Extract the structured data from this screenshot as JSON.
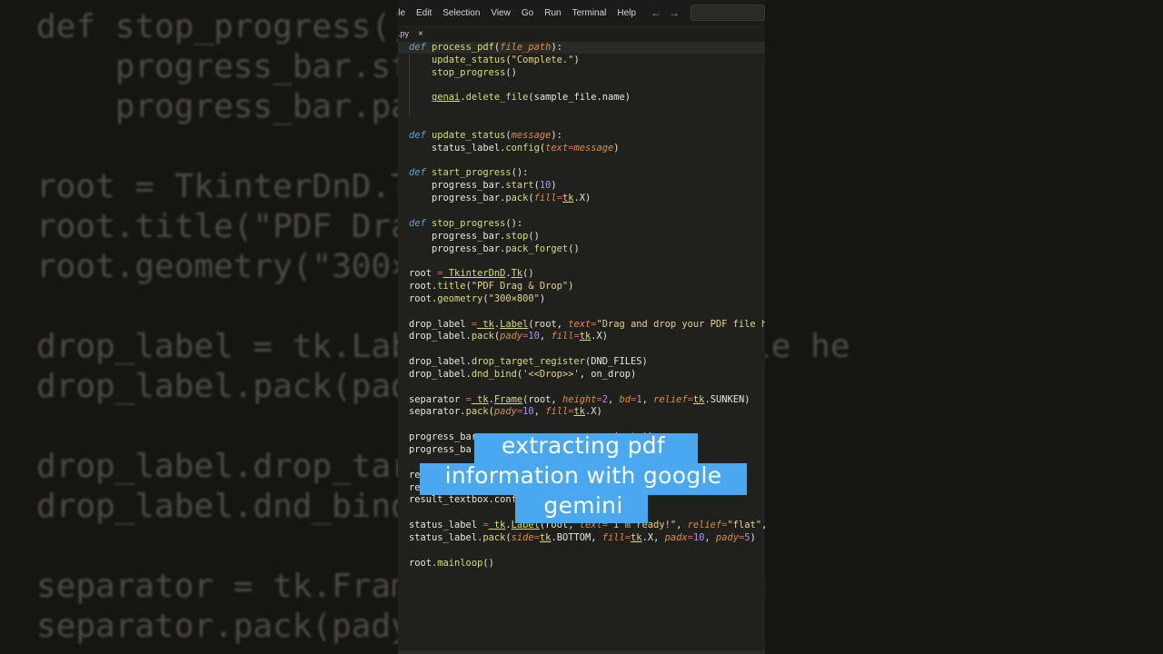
{
  "menubar": {
    "items": [
      "ile",
      "Edit",
      "Selection",
      "View",
      "Go",
      "Run",
      "Terminal",
      "Help"
    ],
    "back_icon": "←",
    "forward_icon": "→"
  },
  "tab": {
    "label": ".py",
    "close": "×"
  },
  "caption": {
    "line1": "extracting pdf",
    "line2": "information with google",
    "line3": "gemini"
  },
  "background": {
    "left_lines": [
      "def stop_progress():",
      "    progress_bar.stop",
      "    progress_bar.pack",
      "",
      "root = TkinterDnD.Tk(",
      "root.title(\"PDF Drag",
      "root.geometry(\"300×80",
      "",
      "drop_label = tk.Label",
      "drop_label.pack(pady",
      "",
      "drop_label.drop_targe",
      "drop_label.dnd_bind(",
      "",
      "separator = tk.Frame(",
      "separator.pack(pady=1"
    ],
    "right_lines": [
      "",
      "",
      "",
      "",
      "",
      "",
      "",
      "",
      "d drop your PDF file he",
      "",
      "",
      "",
      "",
      "",
      ", relief=tk.SUNKEN)",
      ""
    ]
  },
  "colors": {
    "caption_bg": "#49a8ef",
    "editor_bg": "#20201d",
    "keyword": "#6aa0d8",
    "function": "#d8dd7a",
    "string": "#e6d28a",
    "param": "#e08a4a",
    "number": "#b48ef0",
    "operator": "#e06060"
  },
  "code_lines": [
    [
      [
        "k",
        "def "
      ],
      [
        "f",
        "process_pdf"
      ],
      [
        "",
        "("
      ],
      [
        "p",
        "file_path"
      ],
      [
        "",
        "):"
      ]
    ],
    [
      [
        "",
        "    "
      ],
      [
        "f",
        "update_status"
      ],
      [
        "",
        "("
      ],
      [
        "s",
        "\"Complete.\""
      ],
      [
        "",
        ")"
      ]
    ],
    [
      [
        "",
        "    "
      ],
      [
        "f",
        "stop_progress"
      ],
      [
        "",
        "()"
      ]
    ],
    [],
    [
      [
        "",
        "    "
      ],
      [
        "u",
        "genai"
      ],
      [
        "",
        "."
      ],
      [
        "f",
        "delete_file"
      ],
      [
        "",
        "(sample_file.name)"
      ]
    ],
    [],
    [],
    [
      [
        "k",
        "def "
      ],
      [
        "f",
        "update_status"
      ],
      [
        "",
        "("
      ],
      [
        "p",
        "message"
      ],
      [
        "",
        "):"
      ]
    ],
    [
      [
        "",
        "    status_label."
      ],
      [
        "f",
        "config"
      ],
      [
        "",
        "("
      ],
      [
        "p",
        "text"
      ],
      [
        "o",
        "="
      ],
      [
        "p",
        "message"
      ],
      [
        "",
        ")"
      ]
    ],
    [],
    [
      [
        "k",
        "def "
      ],
      [
        "f",
        "start_progress"
      ],
      [
        "",
        "():"
      ]
    ],
    [
      [
        "",
        "    progress_bar."
      ],
      [
        "f",
        "start"
      ],
      [
        "",
        "("
      ],
      [
        "n",
        "10"
      ],
      [
        "",
        ")"
      ]
    ],
    [
      [
        "",
        "    progress_bar."
      ],
      [
        "f",
        "pack"
      ],
      [
        "",
        "("
      ],
      [
        "p",
        "fill"
      ],
      [
        "o",
        "="
      ],
      [
        "u",
        "tk"
      ],
      [
        "",
        ".X)"
      ]
    ],
    [],
    [
      [
        "k",
        "def "
      ],
      [
        "f",
        "stop_progress"
      ],
      [
        "",
        "():"
      ]
    ],
    [
      [
        "",
        "    progress_bar."
      ],
      [
        "f",
        "stop"
      ],
      [
        "",
        "()"
      ]
    ],
    [
      [
        "",
        "    progress_bar."
      ],
      [
        "f",
        "pack_forget"
      ],
      [
        "",
        "()"
      ]
    ],
    [],
    [
      [
        "",
        "root "
      ],
      [
        "o",
        "="
      ],
      [
        "",
        ""
      ],
      [
        "u",
        " TkinterDnD"
      ],
      [
        "",
        "."
      ],
      [
        "u",
        "Tk"
      ],
      [
        "",
        "()"
      ]
    ],
    [
      [
        "",
        "root."
      ],
      [
        "f",
        "title"
      ],
      [
        "",
        "("
      ],
      [
        "s",
        "\"PDF Drag & Drop\""
      ],
      [
        "",
        ")"
      ]
    ],
    [
      [
        "",
        "root."
      ],
      [
        "f",
        "geometry"
      ],
      [
        "",
        "("
      ],
      [
        "s",
        "\"300×800\""
      ],
      [
        "",
        ")"
      ]
    ],
    [],
    [
      [
        "",
        "drop_label "
      ],
      [
        "o",
        "="
      ],
      [
        "u",
        " tk"
      ],
      [
        "",
        "."
      ],
      [
        "u",
        "Label"
      ],
      [
        "",
        "(root, "
      ],
      [
        "p",
        "text"
      ],
      [
        "o",
        "="
      ],
      [
        "s",
        "\"Drag and drop your PDF file he"
      ]
    ],
    [
      [
        "",
        "drop_label."
      ],
      [
        "f",
        "pack"
      ],
      [
        "",
        "("
      ],
      [
        "p",
        "pady"
      ],
      [
        "o",
        "="
      ],
      [
        "n",
        "10"
      ],
      [
        "",
        ", "
      ],
      [
        "p",
        "fill"
      ],
      [
        "o",
        "="
      ],
      [
        "u",
        "tk"
      ],
      [
        "",
        ".X)"
      ]
    ],
    [],
    [
      [
        "",
        "drop_label."
      ],
      [
        "f",
        "drop_target_register"
      ],
      [
        "",
        "(DND_FILES)"
      ]
    ],
    [
      [
        "",
        "drop_label."
      ],
      [
        "f",
        "dnd_bind"
      ],
      [
        "",
        "("
      ],
      [
        "s",
        "'<<Drop>>'"
      ],
      [
        "",
        ", on_drop)"
      ]
    ],
    [],
    [
      [
        "",
        "separator "
      ],
      [
        "o",
        "="
      ],
      [
        "u",
        " tk"
      ],
      [
        "",
        "."
      ],
      [
        "u",
        "Frame"
      ],
      [
        "",
        "(root, "
      ],
      [
        "p",
        "height"
      ],
      [
        "o",
        "="
      ],
      [
        "n",
        "2"
      ],
      [
        "",
        ", "
      ],
      [
        "p",
        "bd"
      ],
      [
        "o",
        "="
      ],
      [
        "n",
        "1"
      ],
      [
        "",
        ", "
      ],
      [
        "p",
        "relief"
      ],
      [
        "o",
        "="
      ],
      [
        "u",
        "tk"
      ],
      [
        "",
        ".SUNKEN)"
      ]
    ],
    [
      [
        "",
        "separator."
      ],
      [
        "f",
        "pack"
      ],
      [
        "",
        "("
      ],
      [
        "p",
        "pady"
      ],
      [
        "o",
        "="
      ],
      [
        "n",
        "10"
      ],
      [
        "",
        ", "
      ],
      [
        "p",
        "fill"
      ],
      [
        "o",
        "="
      ],
      [
        "u",
        "tk"
      ],
      [
        "",
        ".X)"
      ]
    ],
    [],
    [
      [
        "",
        "progress_bar"
      ],
      [
        "",
        "                        "
      ],
      [
        "s",
        "inate'"
      ],
      [
        "",
        ")"
      ]
    ],
    [
      [
        "",
        "progress_ba"
      ]
    ],
    [],
    [
      [
        "",
        "re"
      ],
      [
        "",
        "                                      "
      ],
      [
        "",
        "D)"
      ]
    ],
    [
      [
        "",
        "result_textbox.pack"
      ],
      [
        "",
        "             "
      ],
      [
        "u",
        "tk"
      ],
      [
        "",
        ".BOTH, "
      ],
      [
        "p",
        "expand"
      ],
      [
        "o",
        "="
      ],
      [
        "p",
        "True"
      ]
    ],
    [
      [
        "",
        "result_textbox.conf"
      ]
    ],
    [],
    [
      [
        "",
        "status_label "
      ],
      [
        "o",
        "="
      ],
      [
        "u",
        " tk"
      ],
      [
        "",
        "."
      ],
      [
        "u",
        "Label"
      ],
      [
        "",
        "(root, "
      ],
      [
        "p",
        "text"
      ],
      [
        "o",
        "="
      ],
      [
        "s",
        "\"I'm ready!\""
      ],
      [
        "",
        ", "
      ],
      [
        "p",
        "relief"
      ],
      [
        "o",
        "="
      ],
      [
        "s",
        "\"flat\""
      ],
      [
        "",
        ","
      ]
    ],
    [
      [
        "",
        "status_label."
      ],
      [
        "f",
        "pack"
      ],
      [
        "",
        "("
      ],
      [
        "p",
        "side"
      ],
      [
        "o",
        "="
      ],
      [
        "u",
        "tk"
      ],
      [
        "",
        ".BOTTOM, "
      ],
      [
        "p",
        "fill"
      ],
      [
        "o",
        "="
      ],
      [
        "u",
        "tk"
      ],
      [
        "",
        ".X, "
      ],
      [
        "p",
        "padx"
      ],
      [
        "o",
        "="
      ],
      [
        "n",
        "10"
      ],
      [
        "",
        ", "
      ],
      [
        "p",
        "pady"
      ],
      [
        "o",
        "="
      ],
      [
        "n",
        "5"
      ],
      [
        "",
        ")"
      ]
    ],
    [],
    [
      [
        "",
        "root."
      ],
      [
        "f",
        "mainloop"
      ],
      [
        "",
        "()"
      ]
    ]
  ]
}
